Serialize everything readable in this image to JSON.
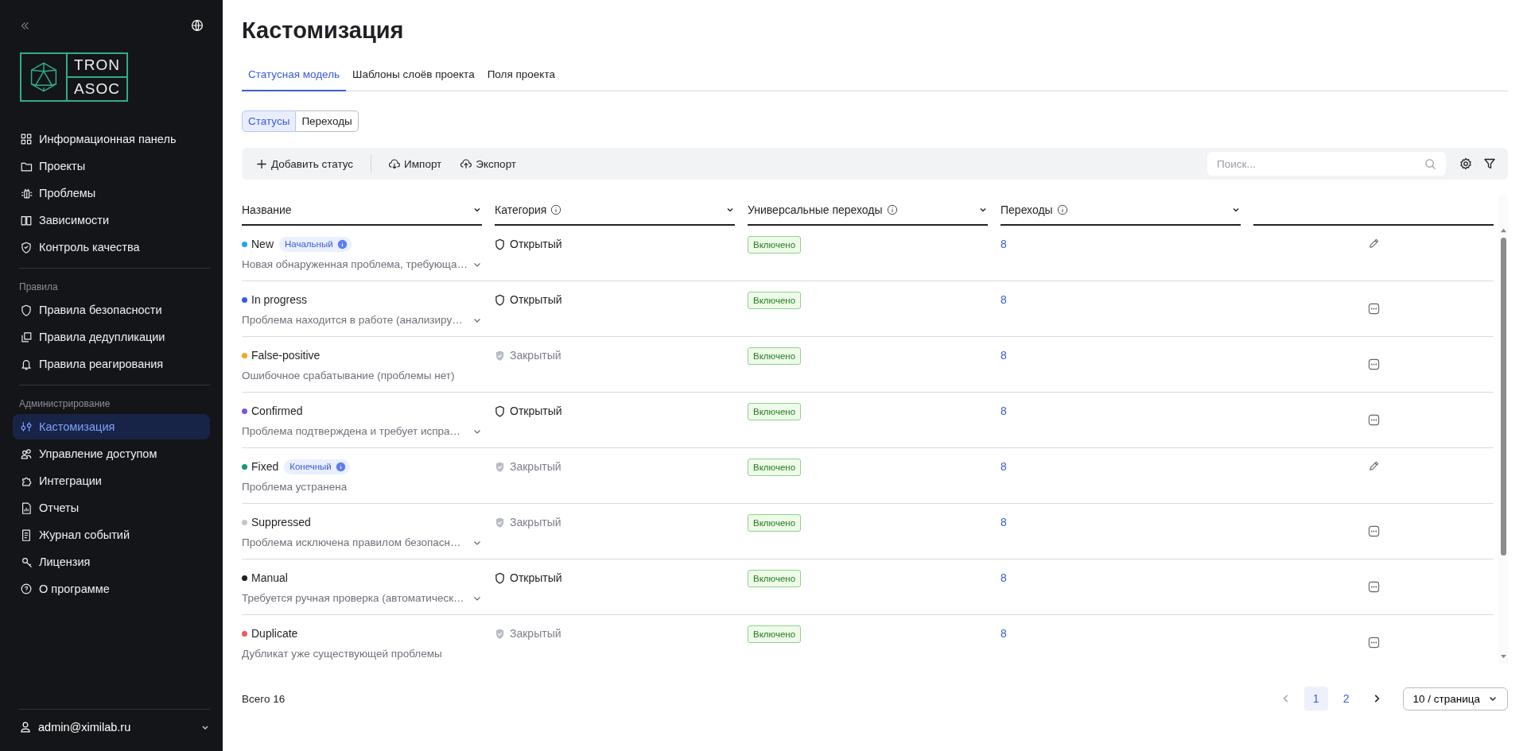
{
  "sidebar": {
    "logo": {
      "line_1": "TRON",
      "line_2": "ASOC"
    },
    "sections": [
      {
        "items": [
          {
            "label": "Информационная панель",
            "selected": false
          },
          {
            "label": "Проекты",
            "selected": false
          },
          {
            "label": "Проблемы",
            "selected": false
          },
          {
            "label": "Зависимости",
            "selected": false
          },
          {
            "label": "Контроль качества",
            "selected": false
          }
        ]
      },
      {
        "heading": "Правила",
        "items": [
          {
            "label": "Правила безопасности",
            "selected": false
          },
          {
            "label": "Правила дедупликации",
            "selected": false
          },
          {
            "label": "Правила реагирования",
            "selected": false
          }
        ]
      },
      {
        "heading": "Администрирование",
        "items": [
          {
            "label": "Кастомизация",
            "selected": true
          },
          {
            "label": "Управление доступом",
            "selected": false
          },
          {
            "label": "Интеграции",
            "selected": false
          },
          {
            "label": "Отчеты",
            "selected": false
          },
          {
            "label": "Журнал событий",
            "selected": false
          },
          {
            "label": "Лицензия",
            "selected": false
          },
          {
            "label": "О программе",
            "selected": false
          }
        ]
      }
    ],
    "user": "admin@ximilab.ru"
  },
  "page": {
    "title": "Кастомизация",
    "tabs": [
      {
        "label": "Статусная модель",
        "selected": true
      },
      {
        "label": "Шаблоны слоёв проекта",
        "selected": false
      },
      {
        "label": "Поля проекта",
        "selected": false
      }
    ],
    "segments": [
      {
        "label": "Статусы",
        "selected": true
      },
      {
        "label": "Переходы",
        "selected": false
      }
    ],
    "toolbar": {
      "buttons": [
        "Добавить статус",
        "Импорт",
        "Экспорт"
      ],
      "search": {
        "placeholder": "Поиск..."
      }
    },
    "table": {
      "columns": [
        {
          "label": "Название",
          "info": false
        },
        {
          "label": "Категория",
          "info": true
        },
        {
          "label": "Универсальные переходы",
          "info": true
        },
        {
          "label": "Переходы",
          "info": true
        },
        {}
      ],
      "rows": [
        {
          "name": "New",
          "color": "#1ea7e8",
          "badge": "Начальный",
          "description": "Новая обнаруженная проблема, требующа…",
          "expandable": true,
          "category": {
            "label": "Открытый",
            "kind": "open"
          },
          "universal": "Включено",
          "transitions": "8",
          "editable": true
        },
        {
          "name": "In progress",
          "color": "#3b5bdb",
          "description": "Проблема находится в работе (анализиру…",
          "expandable": true,
          "category": {
            "label": "Открытый",
            "kind": "open"
          },
          "universal": "Включено",
          "transitions": "8",
          "editable": false
        },
        {
          "name": "False-positive",
          "color": "#f5a623",
          "description": "Ошибочное срабатывание (проблемы нет)",
          "expandable": false,
          "category": {
            "label": "Закрытый",
            "kind": "closed"
          },
          "universal": "Включено",
          "transitions": "8",
          "editable": false
        },
        {
          "name": "Confirmed",
          "color": "#7e57d6",
          "description": "Проблема подтверждена и требует испра…",
          "expandable": true,
          "category": {
            "label": "Открытый",
            "kind": "open"
          },
          "universal": "Включено",
          "transitions": "8",
          "editable": false
        },
        {
          "name": "Fixed",
          "color": "#16967a",
          "badge": "Конечный",
          "description": "Проблема устранена",
          "expandable": false,
          "category": {
            "label": "Закрытый",
            "kind": "closed"
          },
          "universal": "Включено",
          "transitions": "8",
          "editable": true
        },
        {
          "name": "Suppressed",
          "color": "#c4c6cc",
          "description": "Проблема исключена правилом безопасн…",
          "expandable": true,
          "category": {
            "label": "Закрытый",
            "kind": "closed"
          },
          "universal": "Включено",
          "transitions": "8",
          "editable": false
        },
        {
          "name": "Manual",
          "color": "#1f1f24",
          "description": "Требуется ручная проверка (автоматическ…",
          "expandable": true,
          "category": {
            "label": "Открытый",
            "kind": "open"
          },
          "universal": "Включено",
          "transitions": "8",
          "editable": false
        },
        {
          "name": "Duplicate",
          "color": "#f05a5a",
          "description": "Дубликат уже существующей проблемы",
          "expandable": false,
          "category": {
            "label": "Закрытый",
            "kind": "closed"
          },
          "universal": "Включено",
          "transitions": "8",
          "editable": false
        }
      ]
    },
    "footer": {
      "total": "Всего 16",
      "pages": [
        {
          "label": "1",
          "selected": true
        },
        {
          "label": "2",
          "selected": false
        }
      ],
      "page_size": "10 / страница"
    }
  }
}
